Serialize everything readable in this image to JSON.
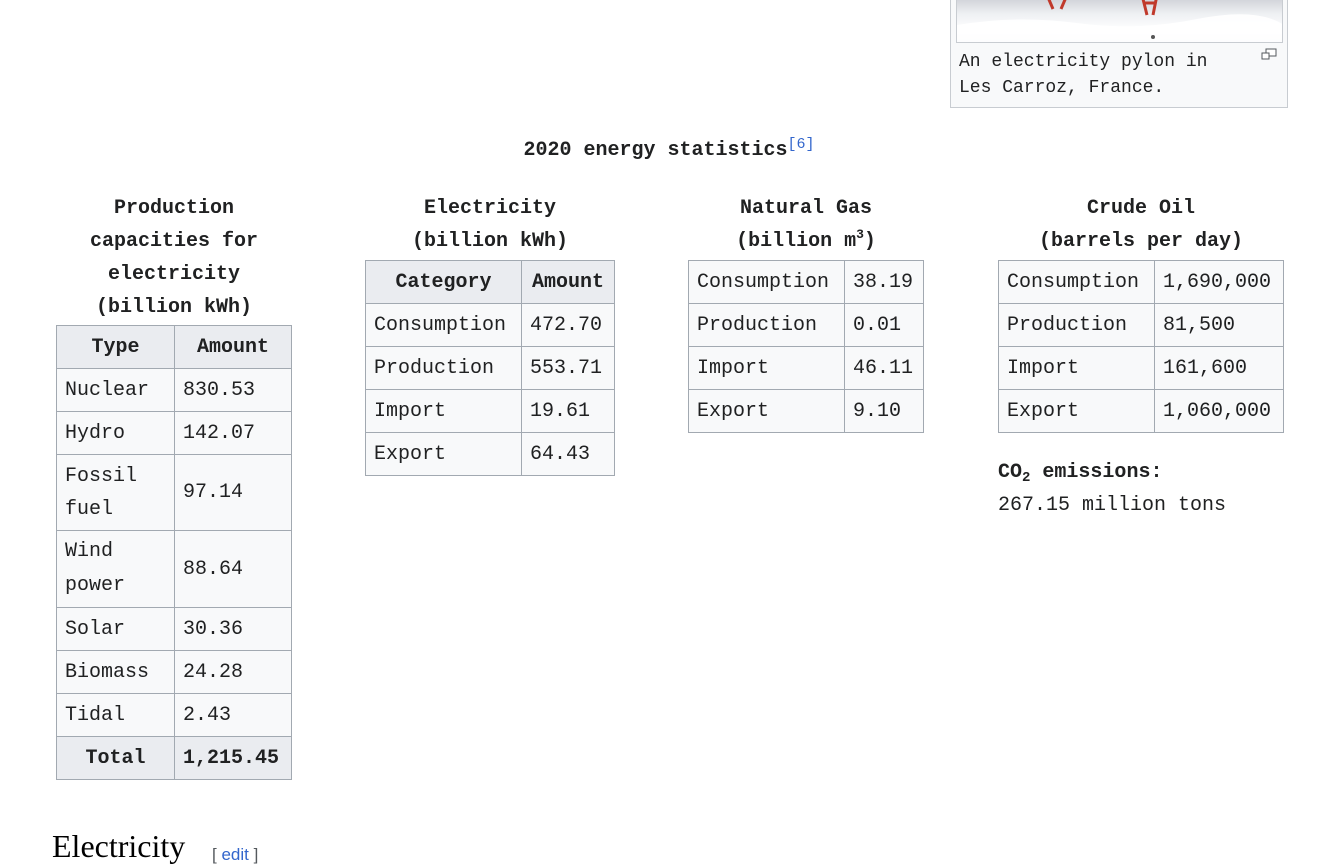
{
  "thumb": {
    "caption": "An electricity pylon in Les Carroz, France."
  },
  "stats": {
    "title": "2020 energy statistics",
    "ref": "[6]"
  },
  "production": {
    "caption": "Production capacities for electricity (billion kWh)",
    "headers": [
      "Type",
      "Amount"
    ],
    "rows": [
      {
        "type": "Nuclear",
        "amount": "830.53"
      },
      {
        "type": "Hydro",
        "amount": "142.07"
      },
      {
        "type": "Fossil fuel",
        "amount": "97.14"
      },
      {
        "type": "Wind power",
        "amount": "88.64"
      },
      {
        "type": "Solar",
        "amount": "30.36"
      },
      {
        "type": "Biomass",
        "amount": "24.28"
      },
      {
        "type": "Tidal",
        "amount": "2.43"
      }
    ],
    "total_label": "Total",
    "total_value": "1,215.45"
  },
  "electricity": {
    "caption_line1": "Electricity",
    "caption_line2": "(billion kWh)",
    "headers": [
      "Category",
      "Amount"
    ],
    "rows": [
      {
        "category": "Consumption",
        "amount": "472.70"
      },
      {
        "category": "Production",
        "amount": "553.71"
      },
      {
        "category": "Import",
        "amount": "19.61"
      },
      {
        "category": "Export",
        "amount": "64.43"
      }
    ]
  },
  "gas": {
    "caption_line1": "Natural Gas",
    "caption_line2_pre": "(billion m",
    "caption_line2_sup": "3",
    "caption_line2_post": ")",
    "rows": [
      {
        "category": "Consumption",
        "amount": "38.19"
      },
      {
        "category": "Production",
        "amount": "0.01"
      },
      {
        "category": "Import",
        "amount": "46.11"
      },
      {
        "category": "Export",
        "amount": "9.10"
      }
    ]
  },
  "oil": {
    "caption_line1": "Crude Oil",
    "caption_line2": "(barrels per day)",
    "rows": [
      {
        "category": "Consumption",
        "amount": "1,690,000"
      },
      {
        "category": "Production",
        "amount": "81,500"
      },
      {
        "category": "Import",
        "amount": "161,600"
      },
      {
        "category": "Export",
        "amount": "1,060,000"
      }
    ]
  },
  "co2": {
    "label_pre": "CO",
    "label_sub": "2",
    "label_post": " emissions:",
    "value": "267.15 million tons"
  },
  "section": {
    "heading": "Electricity",
    "edit_open": "[ ",
    "edit_label": "edit",
    "edit_close": " ]"
  }
}
